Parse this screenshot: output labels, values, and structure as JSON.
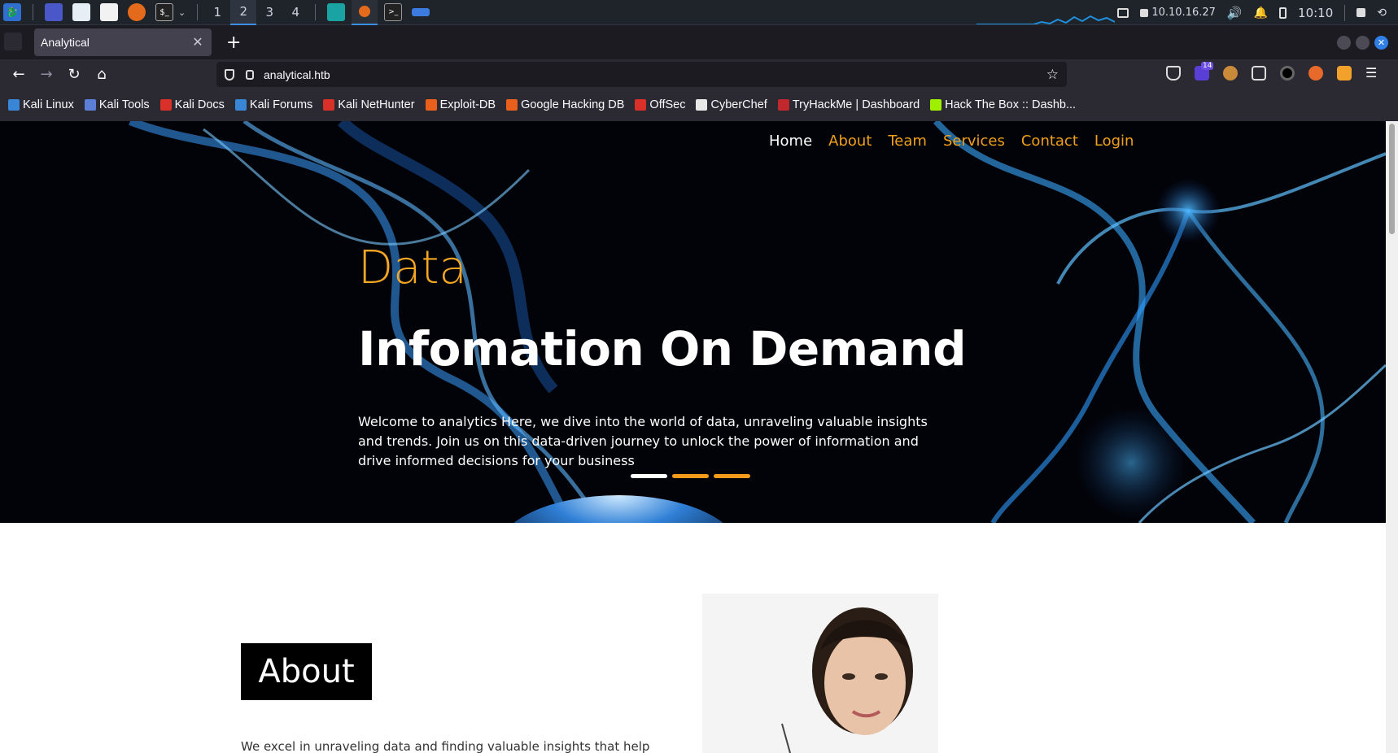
{
  "taskbar": {
    "workspaces": [
      "1",
      "2",
      "3",
      "4"
    ],
    "active_workspace": "2",
    "ip": "10.10.16.27",
    "time": "10:10"
  },
  "browser": {
    "tab_title": "Analytical",
    "url": "analytical.htb",
    "extension_badge": "14",
    "bookmarks": [
      {
        "label": "Kali Linux",
        "color": "#3a86d6"
      },
      {
        "label": "Kali Tools",
        "color": "#5b7fd6"
      },
      {
        "label": "Kali Docs",
        "color": "#d9302a"
      },
      {
        "label": "Kali Forums",
        "color": "#3a86d6"
      },
      {
        "label": "Kali NetHunter",
        "color": "#d9302a"
      },
      {
        "label": "Exploit-DB",
        "color": "#e8601c"
      },
      {
        "label": "Google Hacking DB",
        "color": "#e8601c"
      },
      {
        "label": "OffSec",
        "color": "#d9302a"
      },
      {
        "label": "CyberChef",
        "color": "#e8e8e8"
      },
      {
        "label": "TryHackMe | Dashboard",
        "color": "#c0282d"
      },
      {
        "label": "Hack The Box :: Dashb...",
        "color": "#9fef00"
      }
    ]
  },
  "site": {
    "nav": [
      "Home",
      "About",
      "Team",
      "Services",
      "Contact",
      "Login"
    ],
    "hero_sub": "Data",
    "hero_title": "Infomation On Demand",
    "hero_text": "Welcome to analytics Here, we dive into the world of data, unraveling valuable insights and trends. Join us on this data-driven journey to unlock the power of information and drive informed decisions for your business",
    "about_heading": "About",
    "about_text": "We excel in unraveling data and finding valuable insights that help",
    "accent_color": "#f5a623"
  }
}
